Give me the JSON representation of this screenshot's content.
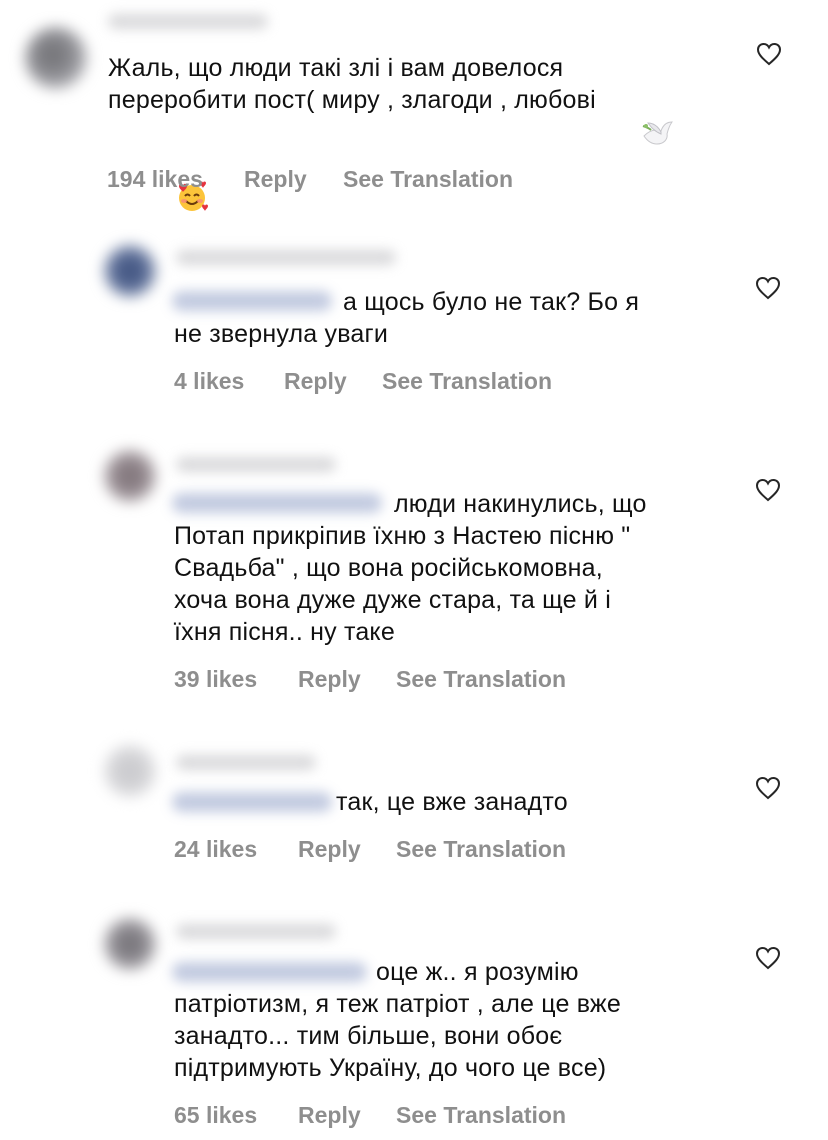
{
  "comments": [
    {
      "text_lines": [
        "Жаль, що люди такі злі і вам довелося",
        "переробити пост( миру , злагоди , любові"
      ],
      "emojis": [
        "dove-emoji",
        "smiling-face-with-hearts-emoji"
      ],
      "likes": "194 likes",
      "reply": "Reply",
      "translate": "See Translation"
    },
    {
      "text_lines": [
        "а щось було не так? Бо я",
        "не звернула уваги"
      ],
      "likes": "4 likes",
      "reply": "Reply",
      "translate": "See Translation"
    },
    {
      "text_lines": [
        "люди накинулись, що",
        "Потап прикріпив їхню з Настею пісню \"",
        "Свадьба\" , що вона російськомовна,",
        "хоча вона дуже дуже стара, та ще й і",
        "їхня пісня.. ну таке"
      ],
      "likes": "39 likes",
      "reply": "Reply",
      "translate": "See Translation"
    },
    {
      "text_lines": [
        "так, це вже занадто"
      ],
      "likes": "24 likes",
      "reply": "Reply",
      "translate": "See Translation"
    },
    {
      "text_lines": [
        "оце ж.. я розумію",
        "патріотизм, я теж патріот , але це вже",
        "занадто... тим більше, вони обоє",
        "підтримують Україну, до чого це все)"
      ],
      "likes": "65 likes",
      "reply": "Reply",
      "translate": "See Translation"
    }
  ],
  "icons": {
    "heart": "heart-outline-icon"
  },
  "colors": {
    "text": "#111111",
    "meta": "#8e8e8e",
    "heart_stroke": "#262626"
  }
}
